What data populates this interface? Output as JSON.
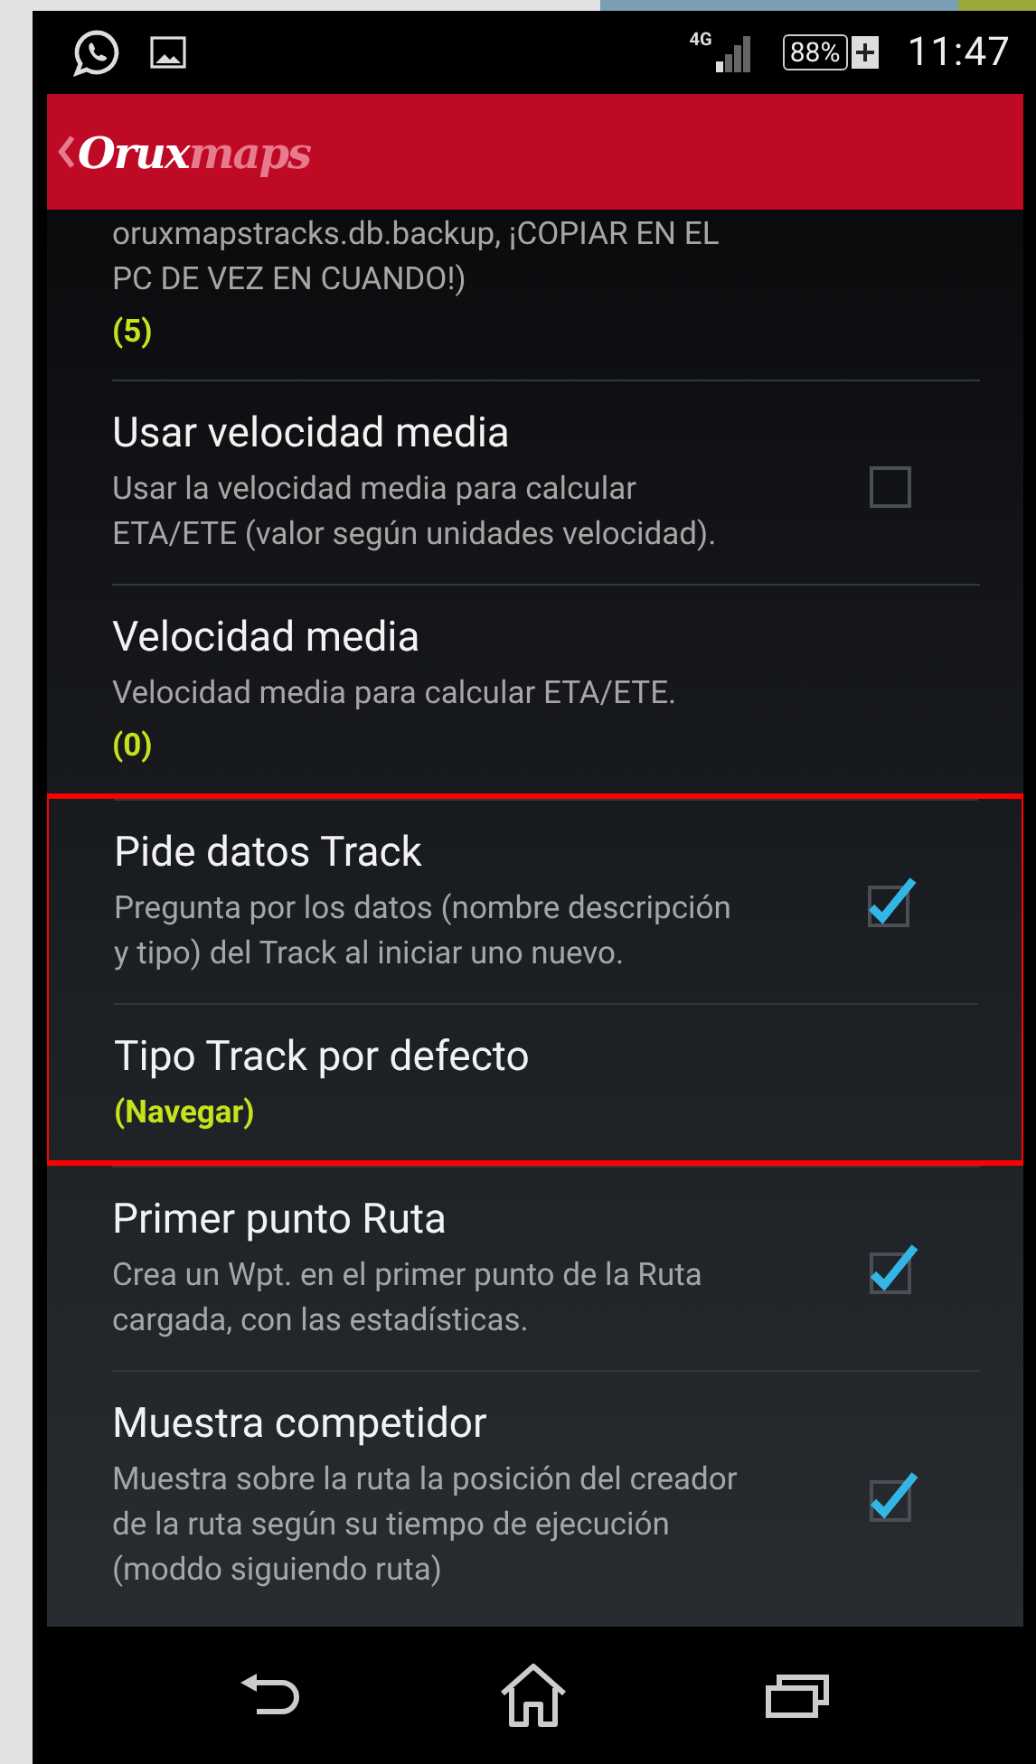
{
  "status_bar": {
    "network": "4G",
    "battery": "88%",
    "time": "11:47"
  },
  "app_bar": {
    "logo": "**Orux**maps"
  },
  "sections": [
    {
      "highlighted": false,
      "items": [
        {
          "kind": "value",
          "summary": "oruxmapstracks.db.backup, ¡COPIAR EN EL PC DE VEZ EN CUANDO!)",
          "value": "(5)"
        },
        {
          "kind": "checkbox",
          "title": "Usar velocidad media",
          "summary": "Usar la velocidad media para calcular ETA/ETE (valor según unidades velocidad).",
          "checked": false
        },
        {
          "kind": "value",
          "title": "Velocidad media",
          "summary": "Velocidad media para calcular ETA/ETE.",
          "value": "(0)"
        }
      ]
    },
    {
      "highlighted": true,
      "items": [
        {
          "kind": "checkbox",
          "title": "Pide datos Track",
          "summary": "Pregunta por los datos (nombre descripción y tipo) del Track al iniciar uno nuevo.",
          "checked": true
        },
        {
          "kind": "value",
          "title": "Tipo Track por defecto",
          "value": "(Navegar)"
        }
      ]
    },
    {
      "highlighted": false,
      "items": [
        {
          "kind": "checkbox",
          "title": "Primer punto Ruta",
          "summary": "Crea un Wpt. en el primer punto de la Ruta cargada, con las estadísticas.",
          "checked": true
        },
        {
          "kind": "checkbox",
          "title": "Muestra competidor",
          "summary": "Muestra sobre la ruta la posición del creador de la ruta según su tiempo de ejecución (moddo siguiendo ruta)",
          "checked": true
        }
      ]
    }
  ]
}
